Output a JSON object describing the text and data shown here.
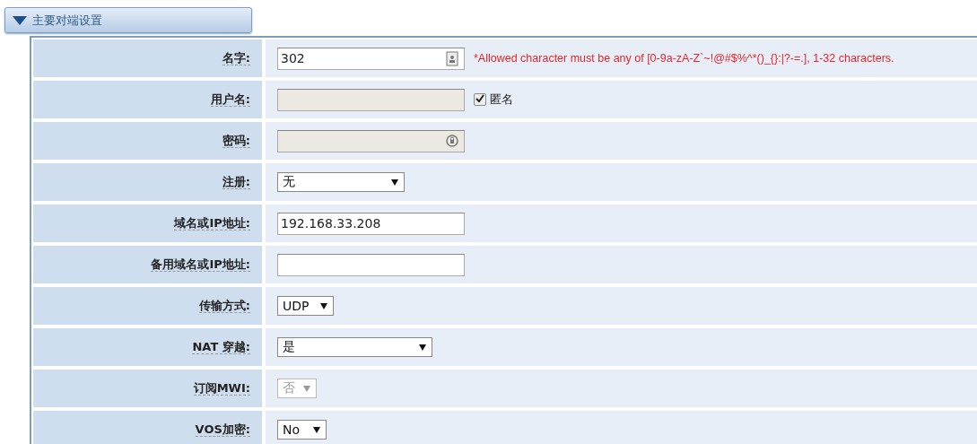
{
  "section": {
    "title": "主要对端设置",
    "expanded": true
  },
  "fields": [
    {
      "label": "名字:",
      "kind": "text",
      "value": "302",
      "disabled": false,
      "note": "*Allowed character must be any of [0-9a-zA-Z`~!@#$%^*()_{}:|?-=.], 1-32 characters."
    },
    {
      "label": "用户名:",
      "kind": "text",
      "disabled": true,
      "checkbox": {
        "label": "匿名",
        "checked": true
      }
    },
    {
      "label": "密码:",
      "kind": "password",
      "disabled": true
    },
    {
      "label": "注册:",
      "kind": "select",
      "value": "无",
      "disabled": false
    },
    {
      "label": "域名或IP地址:",
      "kind": "text",
      "value": "192.168.33.208",
      "disabled": false
    },
    {
      "label": "备用域名或IP地址:",
      "kind": "text",
      "disabled": false
    },
    {
      "label": "传输方式:",
      "kind": "select",
      "value": "UDP",
      "disabled": false
    },
    {
      "label": "NAT 穿越:",
      "kind": "select",
      "value": "是",
      "disabled": false
    },
    {
      "label": "订阅MWI:",
      "kind": "select",
      "value": "否",
      "disabled": true
    },
    {
      "label": "VOS加密:",
      "kind": "select",
      "value": "No",
      "disabled": false
    }
  ]
}
